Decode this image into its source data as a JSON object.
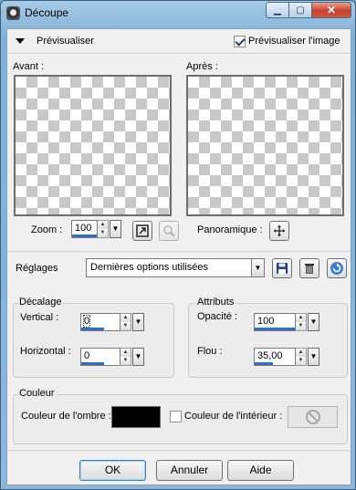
{
  "window": {
    "title": "Découpe",
    "controls": {
      "minimize": "▁",
      "maximize": "▢",
      "close": "✕"
    }
  },
  "preview": {
    "toggle_label": "Prévisualiser",
    "checkbox_label": "Prévisualiser l'image",
    "checkbox_checked": true,
    "before_label": "Avant :",
    "after_label": "Après :"
  },
  "zoom": {
    "label": "Zoom :",
    "value": "100",
    "pan_label": "Panoramique :"
  },
  "settings": {
    "label": "Réglages",
    "selected": "Dernières options utilisées"
  },
  "offset": {
    "title": "Décalage",
    "vertical_label": "Vertical :",
    "vertical_value": "0",
    "horizontal_label": "Horizontal :",
    "horizontal_value": "0"
  },
  "attributes": {
    "title": "Attributs",
    "opacity_label": "Opacité :",
    "opacity_value": "100",
    "blur_label": "Flou :",
    "blur_value": "35,00"
  },
  "color": {
    "title": "Couleur",
    "shadow_label": "Couleur de l'ombre :",
    "shadow_color": "#000000",
    "inside_label": "Couleur de l'intérieur :",
    "inside_checked": false
  },
  "buttons": {
    "ok": "OK",
    "cancel": "Annuler",
    "help": "Aide"
  },
  "icons": {
    "app": "cutout-app-icon",
    "zoom_fit": "fit-window-icon",
    "zoom_magnifier": "magnifier-icon",
    "pan": "move-crosshair-icon",
    "save": "floppy-disk-icon",
    "delete": "trash-icon",
    "reset": "reset-arrow-icon",
    "no_color": "no-symbol-icon"
  }
}
